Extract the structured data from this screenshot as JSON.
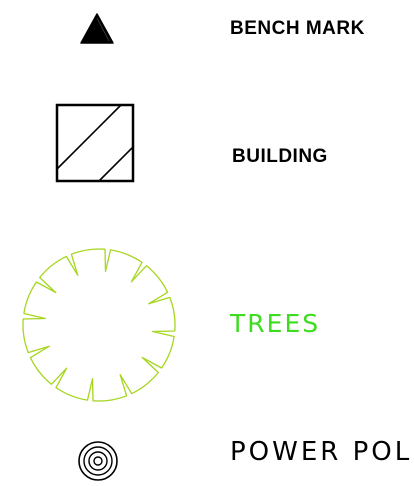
{
  "legend": {
    "items": [
      {
        "id": "bench-mark",
        "label": "BENCH MARK",
        "icon": "triangle-filled-icon",
        "color": "#000000"
      },
      {
        "id": "building",
        "label": "BUILDING",
        "icon": "hatched-square-icon",
        "color": "#000000"
      },
      {
        "id": "trees",
        "label": "TREES",
        "icon": "tree-canopy-icon",
        "color": "#3ddc1f",
        "symbol_color": "#a6d61f"
      },
      {
        "id": "power-pole",
        "label": "POWER POLE",
        "icon": "concentric-circles-icon",
        "color": "#000000"
      }
    ]
  }
}
